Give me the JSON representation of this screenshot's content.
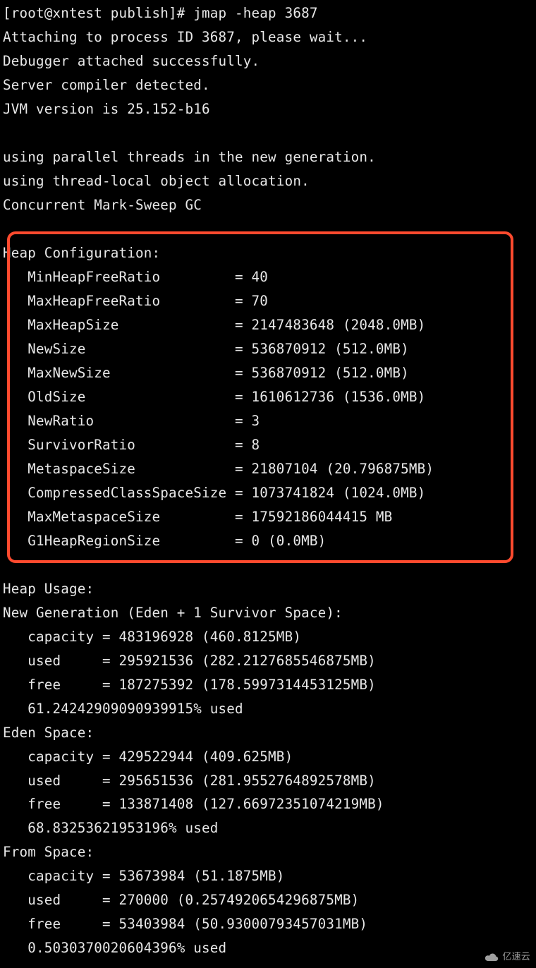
{
  "prompt": "[root@xntest publish]# ",
  "command": "jmap -heap 3687",
  "attaching": "Attaching to process ID 3687, please wait...",
  "debugger": "Debugger attached successfully.",
  "server": "Server compiler detected.",
  "jvm": "JVM version is 25.152-b16",
  "parallel": "using parallel threads in the new generation.",
  "threadlocal": "using thread-local object allocation.",
  "gc": "Concurrent Mark-Sweep GC",
  "heap_config_title": "Heap Configuration:",
  "heap_config": [
    {
      "key": "MinHeapFreeRatio",
      "val": "40"
    },
    {
      "key": "MaxHeapFreeRatio",
      "val": "70"
    },
    {
      "key": "MaxHeapSize",
      "val": "2147483648 (2048.0MB)"
    },
    {
      "key": "NewSize",
      "val": "536870912 (512.0MB)"
    },
    {
      "key": "MaxNewSize",
      "val": "536870912 (512.0MB)"
    },
    {
      "key": "OldSize",
      "val": "1610612736 (1536.0MB)"
    },
    {
      "key": "NewRatio",
      "val": "3"
    },
    {
      "key": "SurvivorRatio",
      "val": "8"
    },
    {
      "key": "MetaspaceSize",
      "val": "21807104 (20.796875MB)"
    },
    {
      "key": "CompressedClassSpaceSize",
      "val": "1073741824 (1024.0MB)"
    },
    {
      "key": "MaxMetaspaceSize",
      "val": "17592186044415 MB"
    },
    {
      "key": "G1HeapRegionSize",
      "val": "0 (0.0MB)"
    }
  ],
  "heap_usage_title": "Heap Usage:",
  "newgen_title": "New Generation (Eden + 1 Survivor Space):",
  "newgen": {
    "capacity": "483196928 (460.8125MB)",
    "used": "295921536 (282.2127685546875MB)",
    "free": "187275392 (178.5997314453125MB)",
    "pct": "61.24242909090939915% used"
  },
  "eden_title": "Eden Space:",
  "eden": {
    "capacity": "429522944 (409.625MB)",
    "used": "295651536 (281.9552764892578MB)",
    "free": "133871408 (127.66972351074219MB)",
    "pct": "68.83253621953196% used"
  },
  "from_title": "From Space:",
  "from": {
    "capacity": "53673984 (51.1875MB)",
    "used": "270000 (0.2574920654296875MB)",
    "free": "53403984 (50.93000793457031MB)",
    "pct": "0.5030370020604396% used"
  },
  "watermark": "亿速云"
}
